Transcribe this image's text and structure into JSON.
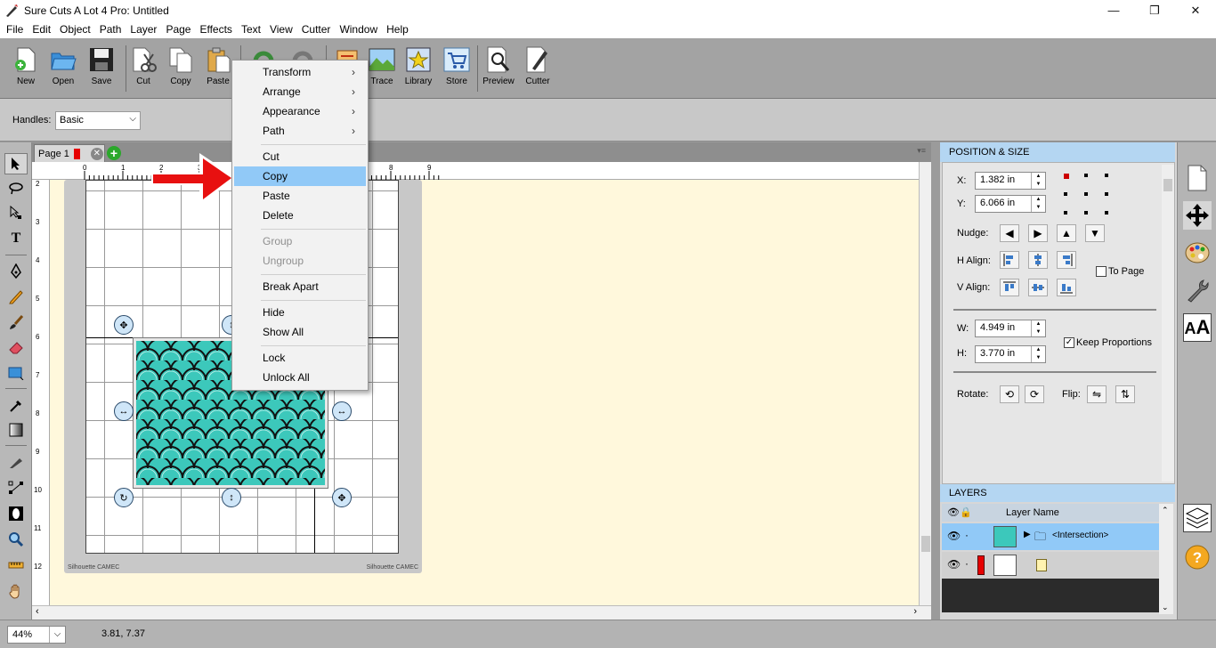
{
  "window": {
    "title": "Sure Cuts A Lot 4 Pro: Untitled",
    "min": "—",
    "max": "❐",
    "close": "✕"
  },
  "menu": [
    "File",
    "Edit",
    "Object",
    "Path",
    "Layer",
    "Page",
    "Effects",
    "Text",
    "View",
    "Cutter",
    "Window",
    "Help"
  ],
  "toolbar": {
    "new": "New",
    "open": "Open",
    "save": "Save",
    "cut": "Cut",
    "copy": "Copy",
    "paste": "Paste",
    "trace": "Trace",
    "library": "Library",
    "store": "Store",
    "preview": "Preview",
    "cutter": "Cutter"
  },
  "handles": {
    "label": "Handles:",
    "value": "Basic"
  },
  "page_tab": {
    "label": "Page 1"
  },
  "rulers": {
    "h": [
      "0",
      "1",
      "2",
      "3",
      "8",
      "9"
    ],
    "v": [
      "2",
      "3",
      "4",
      "5",
      "6",
      "7",
      "8",
      "9",
      "10",
      "11",
      "12"
    ]
  },
  "mat": {
    "label_left": "Silhouette CAMEC",
    "label_right": "Silhouette CAMEC"
  },
  "context_menu": {
    "transform": "Transform",
    "arrange": "Arrange",
    "appearance": "Appearance",
    "path": "Path",
    "cut": "Cut",
    "copy": "Copy",
    "paste": "Paste",
    "delete": "Delete",
    "group": "Group",
    "ungroup": "Ungroup",
    "break_apart": "Break Apart",
    "hide": "Hide",
    "show_all": "Show All",
    "lock": "Lock",
    "unlock_all": "Unlock All"
  },
  "position_size": {
    "header": "POSITION & SIZE",
    "x_label": "X:",
    "x_value": "1.382 in",
    "y_label": "Y:",
    "y_value": "6.066 in",
    "nudge_label": "Nudge:",
    "halign_label": "H Align:",
    "valign_label": "V Align:",
    "to_page": "To Page",
    "w_label": "W:",
    "w_value": "4.949 in",
    "h_label": "H:",
    "h_value": "3.770 in",
    "keep_proportions": "Keep Proportions",
    "rotate_label": "Rotate:",
    "flip_label": "Flip:"
  },
  "layers": {
    "header": "LAYERS",
    "col_name": "Layer Name",
    "row1_name": "<Intersection>"
  },
  "status": {
    "zoom": "44%",
    "coords": "3.81, 7.37"
  },
  "colors": {
    "accent": "#91c9f7",
    "pattern_fill": "#3cc8bb",
    "arrow": "#e81010"
  }
}
